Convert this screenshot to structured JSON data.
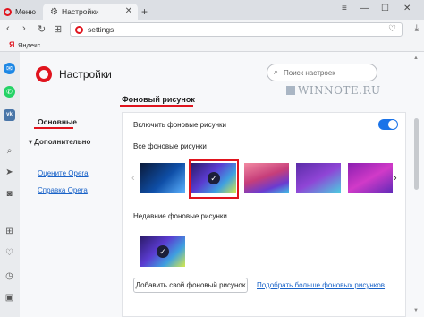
{
  "tabs": {
    "menu_label": "Меню",
    "active_label": "Настройки",
    "close_glyph": "✕",
    "new_tab_glyph": "+"
  },
  "window": {
    "minimize": "—",
    "restore": "☐",
    "close": "✕",
    "menu": "≡"
  },
  "addressbar": {
    "back": "‹",
    "forward": "›",
    "reload": "↻",
    "speed_dial": "⊞",
    "url": "settings",
    "heart": "♡",
    "download": "⤓"
  },
  "bookmarks": {
    "yandex_icon": "Я",
    "yandex_label": "Яндекс"
  },
  "sidebar_icons": [
    "messenger-icon",
    "whatsapp-icon",
    "vk-icon",
    "history-icon",
    "send-icon",
    "camera-icon",
    "apps-icon",
    "heart-icon",
    "clock-icon",
    "wallet-icon"
  ],
  "header": {
    "title": "Настройки",
    "search_placeholder": "Поиск настроек",
    "watermark": "WINNOTE.RU"
  },
  "nav": {
    "basic": "Основные",
    "advanced": "Дополнительно",
    "advanced_arrow": "▾",
    "rate_opera": "Оцените Opera",
    "help": "Справка Opera"
  },
  "section": {
    "title": "Фоновый рисунок",
    "enable_label": "Включить фоновые рисунки",
    "enabled": true,
    "all_label": "Все фоновые рисунки",
    "recent_label": "Недавние фоновые рисунки",
    "add_button": "Добавить свой фоновый рисунок",
    "more_link": "Подобрать больше фоновых рисунков",
    "prev": "‹",
    "next": "›",
    "check": "✓"
  },
  "accent_color": "#e0141e",
  "link_color": "#1a63c8",
  "toggle_color": "#1a73e8"
}
